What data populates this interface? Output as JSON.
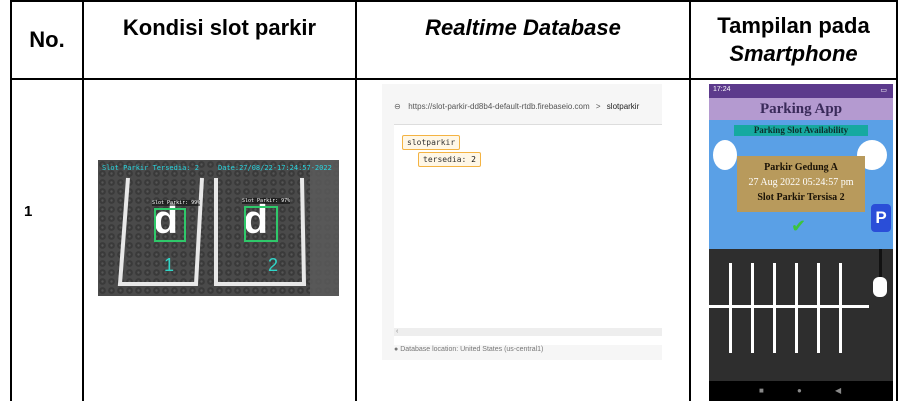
{
  "table": {
    "headers": {
      "no": "No.",
      "kondisi": "Kondisi slot parkir",
      "realtime": "Realtime Database",
      "tampilan_line1": "Tampilan pada",
      "tampilan_line2": "Smartphone"
    },
    "rows": [
      {
        "no": "1"
      }
    ]
  },
  "photo": {
    "overlay_left": "Slot Parkir Tersedia: 2",
    "overlay_right": "Date:27/08/22-17:24:57-2022",
    "bbox_label_1": "Slot Parkir: 99%",
    "bbox_label_2": "Slot Parkir: 97%",
    "slot_1": "1",
    "slot_2": "2"
  },
  "firebase": {
    "url": "https://slot-parkir-dd8b4-default-rtdb.firebaseio.com",
    "separator": ">",
    "path": "slotparkir",
    "root_node": "slotparkir",
    "child_key": "tersedia",
    "child_value": "2",
    "footer": "Database location: United States (us-central1)"
  },
  "phone": {
    "status_time": "17:24",
    "app_title": "Parking App",
    "availability_label": "Parking Slot Availability",
    "location": "Parkir Gedung A",
    "datetime": "27 Aug 2022 05:24:57 pm",
    "slots_left": "Slot Parkir Tersisa 2",
    "parking_sign": "P"
  },
  "colors": {
    "grid": "#000000",
    "firebase_node_border": "#f4b342",
    "phone_appbar": "#b49ad0",
    "phone_sky": "#5aa0e6",
    "phone_availability": "#16a9a0",
    "phone_infobox": "#b89a5c"
  }
}
